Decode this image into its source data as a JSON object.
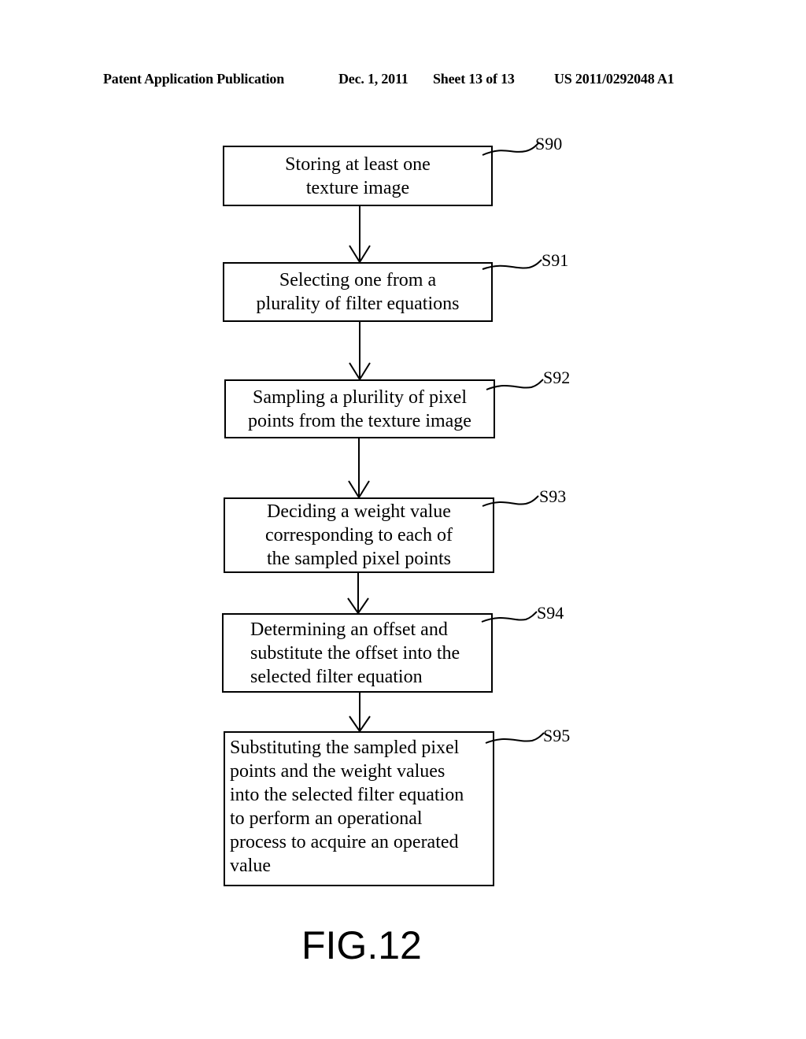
{
  "header": {
    "publication": "Patent Application Publication",
    "date": "Dec. 1, 2011",
    "sheet": "Sheet 13 of 13",
    "number": "US 2011/0292048 A1"
  },
  "steps": [
    {
      "label": "S90",
      "lines": [
        "Storing at least one",
        "texture image"
      ]
    },
    {
      "label": "S91",
      "lines": [
        "Selecting one from a",
        "plurality of filter equations"
      ]
    },
    {
      "label": "S92",
      "lines": [
        "Sampling a plurility of pixel",
        "points from the texture image"
      ]
    },
    {
      "label": "S93",
      "lines": [
        "Deciding a weight value",
        "corresponding to each of",
        "the sampled pixel points"
      ]
    },
    {
      "label": "S94",
      "lines": [
        "Determining an offset and",
        "substitute the offset into the",
        "selected filter equation"
      ]
    },
    {
      "label": "S95",
      "lines": [
        "Substituting the sampled pixel",
        "points and the weight values",
        "into the selected filter equation",
        "to perform an operational",
        "process to acquire an operated",
        "value"
      ]
    }
  ],
  "figure_label": "FIG.12"
}
